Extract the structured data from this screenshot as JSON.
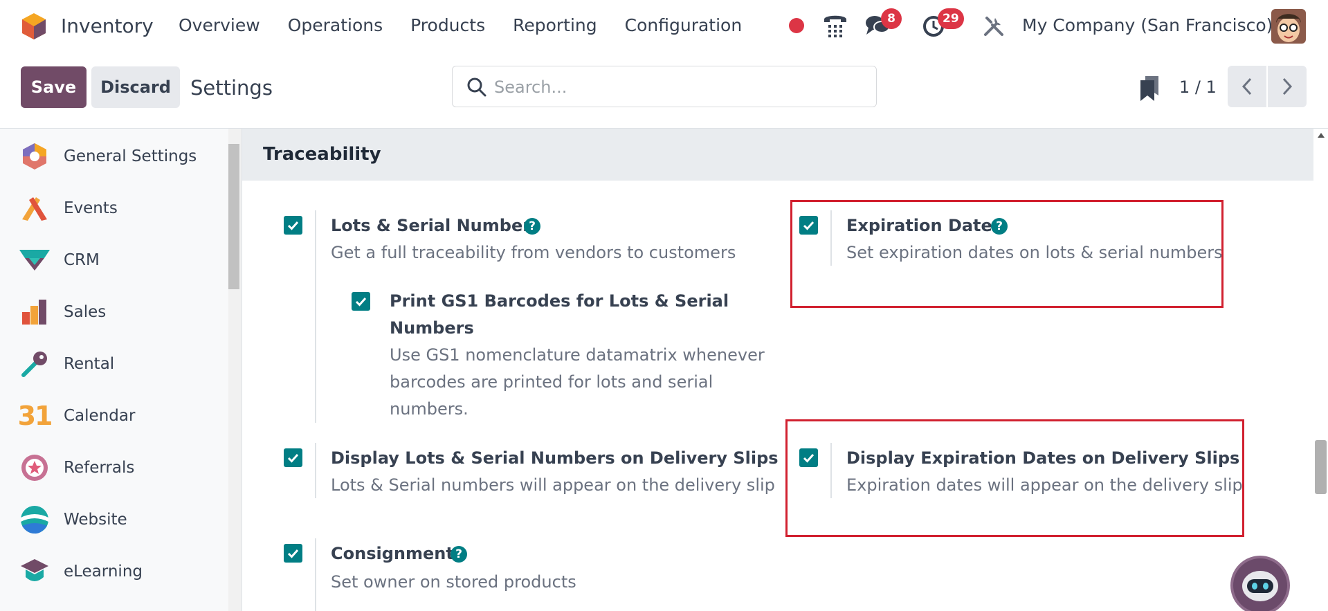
{
  "app": {
    "name": "Inventory"
  },
  "menu": [
    {
      "label": "Overview"
    },
    {
      "label": "Operations"
    },
    {
      "label": "Products"
    },
    {
      "label": "Reporting"
    },
    {
      "label": "Configuration"
    }
  ],
  "systray": {
    "messages_count": "8",
    "activities_count": "29",
    "company": "My Company (San Francisco)"
  },
  "control_panel": {
    "save_label": "Save",
    "discard_label": "Discard",
    "title": "Settings",
    "search_placeholder": "Search...",
    "pager": "1 / 1"
  },
  "sidebar": {
    "items": [
      {
        "label": "General Settings"
      },
      {
        "label": "Events"
      },
      {
        "label": "CRM"
      },
      {
        "label": "Sales"
      },
      {
        "label": "Rental"
      },
      {
        "label": "Calendar"
      },
      {
        "label": "Referrals"
      },
      {
        "label": "Website"
      },
      {
        "label": "eLearning"
      }
    ]
  },
  "calendar_icon_text": "31",
  "section": {
    "title": "Traceability",
    "settings": {
      "lots": {
        "title": "Lots & Serial Numbers",
        "desc": "Get a full traceability from vendors to customers",
        "checked": true
      },
      "gs1": {
        "title_line1": "Print GS1 Barcodes for Lots & Serial",
        "title_line2": "Numbers",
        "desc_line1": "Use GS1 nomenclature datamatrix whenever",
        "desc_line2": "barcodes are printed for lots and serial",
        "desc_line3": "numbers.",
        "checked": true
      },
      "display_lots": {
        "title": "Display Lots & Serial Numbers on Delivery Slips",
        "desc": "Lots & Serial numbers will appear on the delivery slip",
        "checked": true
      },
      "consignment": {
        "title": "Consignment",
        "desc": "Set owner on stored products",
        "checked": true
      },
      "expiration": {
        "title": "Expiration Dates",
        "desc": "Set expiration dates on lots & serial numbers",
        "checked": true
      },
      "display_expiration": {
        "title": "Display Expiration Dates on Delivery Slips",
        "desc": "Expiration dates will appear on the delivery slip",
        "checked": true
      }
    }
  },
  "colors": {
    "primary": "#714b67",
    "checkbox": "#017e84",
    "highlight": "#d1202f",
    "badge": "#dc3545"
  }
}
